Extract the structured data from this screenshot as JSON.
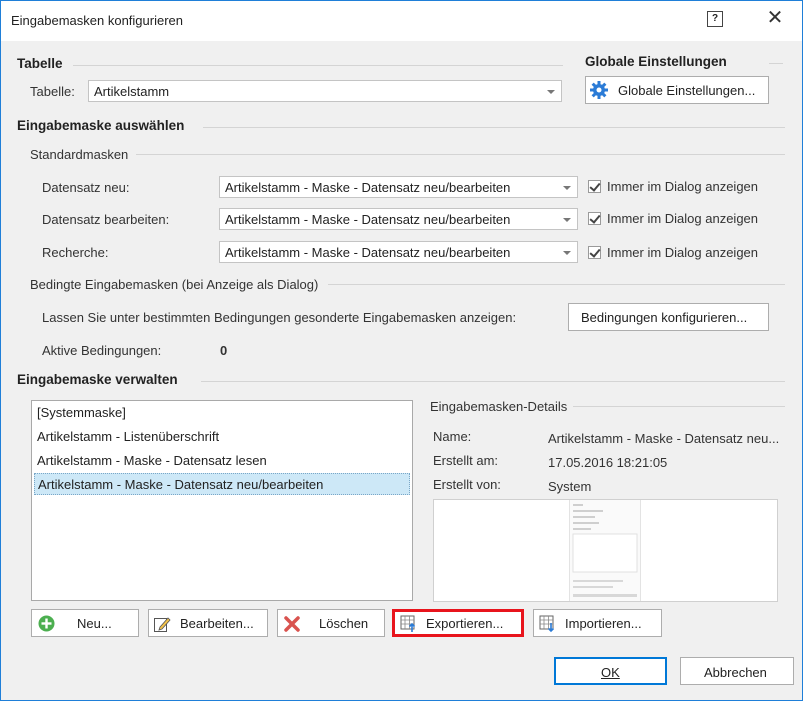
{
  "window": {
    "title": "Eingabemasken konfigurieren",
    "help_glyph": "?",
    "close_glyph": "✕"
  },
  "tabelle": {
    "section_title": "Tabelle",
    "label": "Tabelle:",
    "value": "Artikelstamm"
  },
  "global": {
    "section_title": "Globale Einstellungen",
    "button_label": "Globale Einstellungen...",
    "icon": "gear-icon"
  },
  "auswahl": {
    "section_title": "Eingabemaske auswählen",
    "standard_title": "Standardmasken",
    "rows": [
      {
        "label": "Datensatz neu:",
        "value": "Artikelstamm - Maske - Datensatz neu/bearbeiten",
        "check_label": "Immer im Dialog anzeigen",
        "checked": true
      },
      {
        "label": "Datensatz bearbeiten:",
        "value": "Artikelstamm - Maske - Datensatz neu/bearbeiten",
        "check_label": "Immer im Dialog anzeigen",
        "checked": true
      },
      {
        "label": "Recherche:",
        "value": "Artikelstamm - Maske - Datensatz neu/bearbeiten",
        "check_label": "Immer im Dialog anzeigen",
        "checked": true
      }
    ],
    "bedingt_title": "Bedingte Eingabemasken (bei Anzeige als Dialog)",
    "bedingt_text": "Lassen Sie unter bestimmten Bedingungen gesonderte Eingabemasken anzeigen:",
    "bedingt_button": "Bedingungen konfigurieren...",
    "aktive_label": "Aktive Bedingungen:",
    "aktive_value": "0"
  },
  "verwalten": {
    "section_title": "Eingabemaske verwalten",
    "items": [
      "[Systemmaske]",
      "Artikelstamm - Listenüberschrift",
      "Artikelstamm - Maske - Datensatz lesen",
      "Artikelstamm - Maske - Datensatz neu/bearbeiten"
    ],
    "selected_index": 3,
    "details_title": "Eingabemasken-Details",
    "details": {
      "name_label": "Name:",
      "name_value": "Artikelstamm - Maske - Datensatz neu...",
      "created_label": "Erstellt am:",
      "created_value": "17.05.2016 18:21:05",
      "author_label": "Erstellt von:",
      "author_value": "System"
    },
    "buttons": {
      "neu": "Neu...",
      "bearbeiten": "Bearbeiten...",
      "loeschen": "Löschen",
      "exportieren": "Exportieren...",
      "importieren": "Importieren..."
    }
  },
  "footer": {
    "ok": "OK",
    "cancel": "Abbrechen"
  },
  "colors": {
    "accent": "#0078d7",
    "highlight": "#e8141c",
    "selection": "#cde8f7",
    "add_green": "#4caf50",
    "delete_red": "#d9534f"
  }
}
